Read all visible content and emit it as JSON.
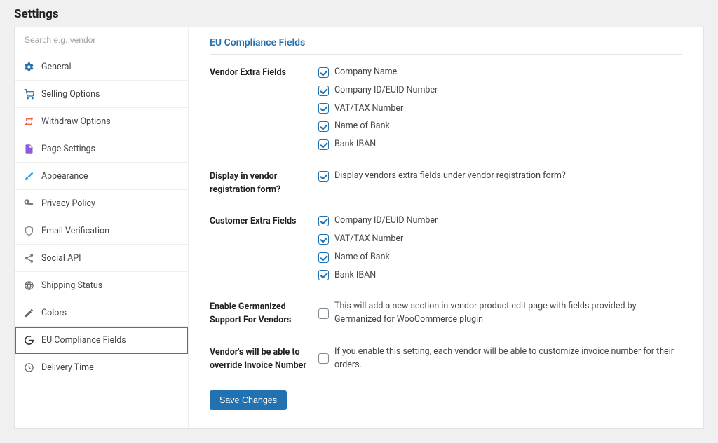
{
  "page_title": "Settings",
  "search_placeholder": "Search e.g. vendor",
  "sidebar": {
    "items": [
      {
        "label": "General",
        "icon": "gear",
        "color": "#2271b1"
      },
      {
        "label": "Selling Options",
        "icon": "cart",
        "color": "#2271b1"
      },
      {
        "label": "Withdraw Options",
        "icon": "arrows",
        "color": "#f05025"
      },
      {
        "label": "Page Settings",
        "icon": "page",
        "color": "#8e5cd9"
      },
      {
        "label": "Appearance",
        "icon": "brush",
        "color": "#3aa2de"
      },
      {
        "label": "Privacy Policy",
        "icon": "key",
        "color": "#777"
      },
      {
        "label": "Email Verification",
        "icon": "shield",
        "color": "#888"
      },
      {
        "label": "Social API",
        "icon": "share",
        "color": "#777"
      },
      {
        "label": "Shipping Status",
        "icon": "globe",
        "color": "#666"
      },
      {
        "label": "Colors",
        "icon": "pen",
        "color": "#666"
      },
      {
        "label": "EU Compliance Fields",
        "icon": "google",
        "color": "#333"
      },
      {
        "label": "Delivery Time",
        "icon": "clock",
        "color": "#666"
      }
    ]
  },
  "section_title": "EU Compliance Fields",
  "rows": {
    "vendor_extra_label": "Vendor Extra Fields",
    "vendor_extra_items": [
      "Company Name",
      "Company ID/EUID Number",
      "VAT/TAX Number",
      "Name of Bank",
      "Bank IBAN"
    ],
    "display_reg_label": "Display in vendor registration form?",
    "display_reg_text": "Display vendors extra fields under vendor registration form?",
    "customer_extra_label": "Customer Extra Fields",
    "customer_extra_items": [
      "Company ID/EUID Number",
      "VAT/TAX Number",
      "Name of Bank",
      "Bank IBAN"
    ],
    "germanized_label": "Enable Germanized Support For Vendors",
    "germanized_text": "This will add a new section in vendor product edit page with fields provided by Germanized for WooCommerce plugin",
    "invoice_label": "Vendor's will be able to override Invoice Number",
    "invoice_text": "If you enable this setting, each vendor will be able to customize invoice number for their orders."
  },
  "save_label": "Save Changes"
}
